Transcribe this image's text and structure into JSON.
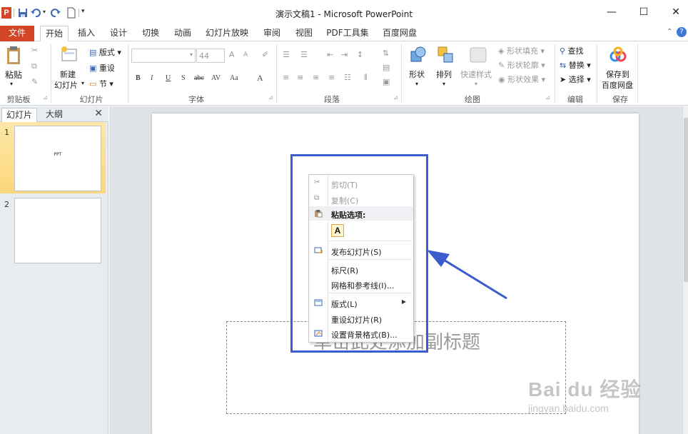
{
  "window": {
    "title": "演示文稿1 - Microsoft PowerPoint",
    "app_icon_letter": "P",
    "min_glyph": "—",
    "max_glyph": "☐",
    "close_glyph": "✕"
  },
  "ribbon_tabs": [
    "文件",
    "开始",
    "插入",
    "设计",
    "切换",
    "动画",
    "幻灯片放映",
    "审阅",
    "视图",
    "PDF工具集",
    "百度网盘"
  ],
  "ribbon": {
    "clipboard": {
      "paste": "粘贴",
      "group": "剪贴板"
    },
    "slides": {
      "new_slide_1": "新建",
      "new_slide_2": "幻灯片",
      "layout": "版式",
      "reset": "重设",
      "section": "节",
      "group": "幻灯片"
    },
    "font": {
      "size": "44",
      "group": "字体",
      "bold": "B",
      "italic": "I",
      "underline": "U",
      "shadow": "S",
      "strike": "abc",
      "spacing": "AV",
      "case": "Aa",
      "grow": "A",
      "shrink": "A"
    },
    "paragraph": {
      "group": "段落"
    },
    "drawing": {
      "shapes": "形状",
      "arrange": "排列",
      "quick_styles": "快速样式",
      "fill": "形状填充",
      "outline": "形状轮廓",
      "effects": "形状效果",
      "group": "绘图"
    },
    "editing": {
      "find": "查找",
      "replace": "替换",
      "select": "选择",
      "group": "编辑"
    },
    "save": {
      "line1": "保存到",
      "line2": "百度网盘",
      "group": "保存"
    }
  },
  "left_panel": {
    "tab_slides": "幻灯片",
    "tab_outline": "大纲",
    "close": "✕",
    "slides": [
      {
        "number": "1",
        "text": "PPT"
      },
      {
        "number": "2",
        "text": ""
      }
    ]
  },
  "slide": {
    "subtitle_placeholder": "单击此处添加副标题"
  },
  "context_menu": {
    "cut": "剪切(T)",
    "copy": "复制(C)",
    "paste_options": "粘贴选项:",
    "paste_keep_text": "A",
    "publish": "发布幻灯片(S)",
    "ruler": "标尺(R)",
    "grid": "网格和参考线(I)...",
    "layout": "版式(L)",
    "reset": "重设幻灯片(R)",
    "background": "设置背景格式(B)..."
  },
  "watermark": {
    "brand": "Bai du 经验",
    "url": "jingyan.baidu.com"
  },
  "colors": {
    "file_tab": "#d24625",
    "highlight": "#3a5ccc",
    "selected_thumb": "#fbd77a"
  }
}
